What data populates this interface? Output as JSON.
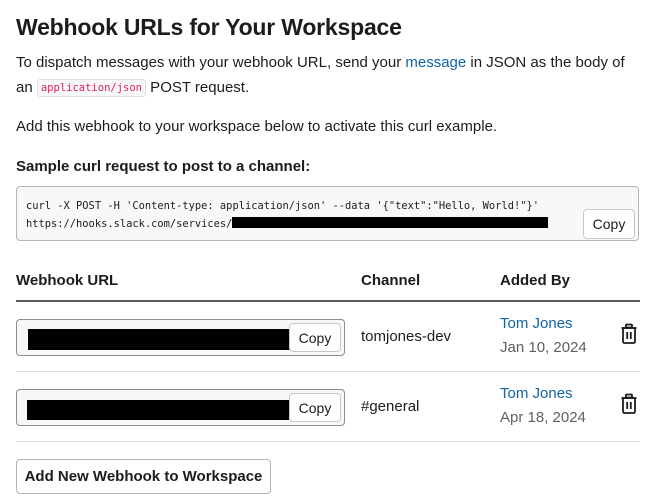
{
  "page": {
    "title": "Webhook URLs for Your Workspace",
    "intro": {
      "before_link": "To dispatch messages with your webhook URL, send your ",
      "link_text": "message",
      "after_link": " in JSON as the body of an ",
      "code": "application/json",
      "after_code": " POST request."
    },
    "activate_note": "Add this webhook to your workspace below to activate this curl example."
  },
  "sample": {
    "label": "Sample curl request to post to a channel:",
    "line1": "curl -X POST -H 'Content-type: application/json' --data '{\"text\":\"Hello, World!\"}'",
    "line2_prefix": "https://hooks.slack.com/services/",
    "copy_label": "Copy"
  },
  "table": {
    "headers": {
      "url": "Webhook URL",
      "channel": "Channel",
      "added_by": "Added By"
    },
    "rows": [
      {
        "copy_label": "Copy",
        "channel": "tomjones-dev",
        "added_by": "Tom Jones",
        "date": "Jan 10, 2024"
      },
      {
        "copy_label": "Copy",
        "channel": "#general",
        "added_by": "Tom Jones",
        "date": "Apr 18, 2024"
      }
    ]
  },
  "actions": {
    "add_webhook_label": "Add New Webhook to Workspace"
  },
  "colors": {
    "link": "#1264a3",
    "code_text": "#e01e5a",
    "text": "#1d1c1d",
    "muted": "#616061"
  },
  "icons": {
    "delete": "trash-icon"
  }
}
